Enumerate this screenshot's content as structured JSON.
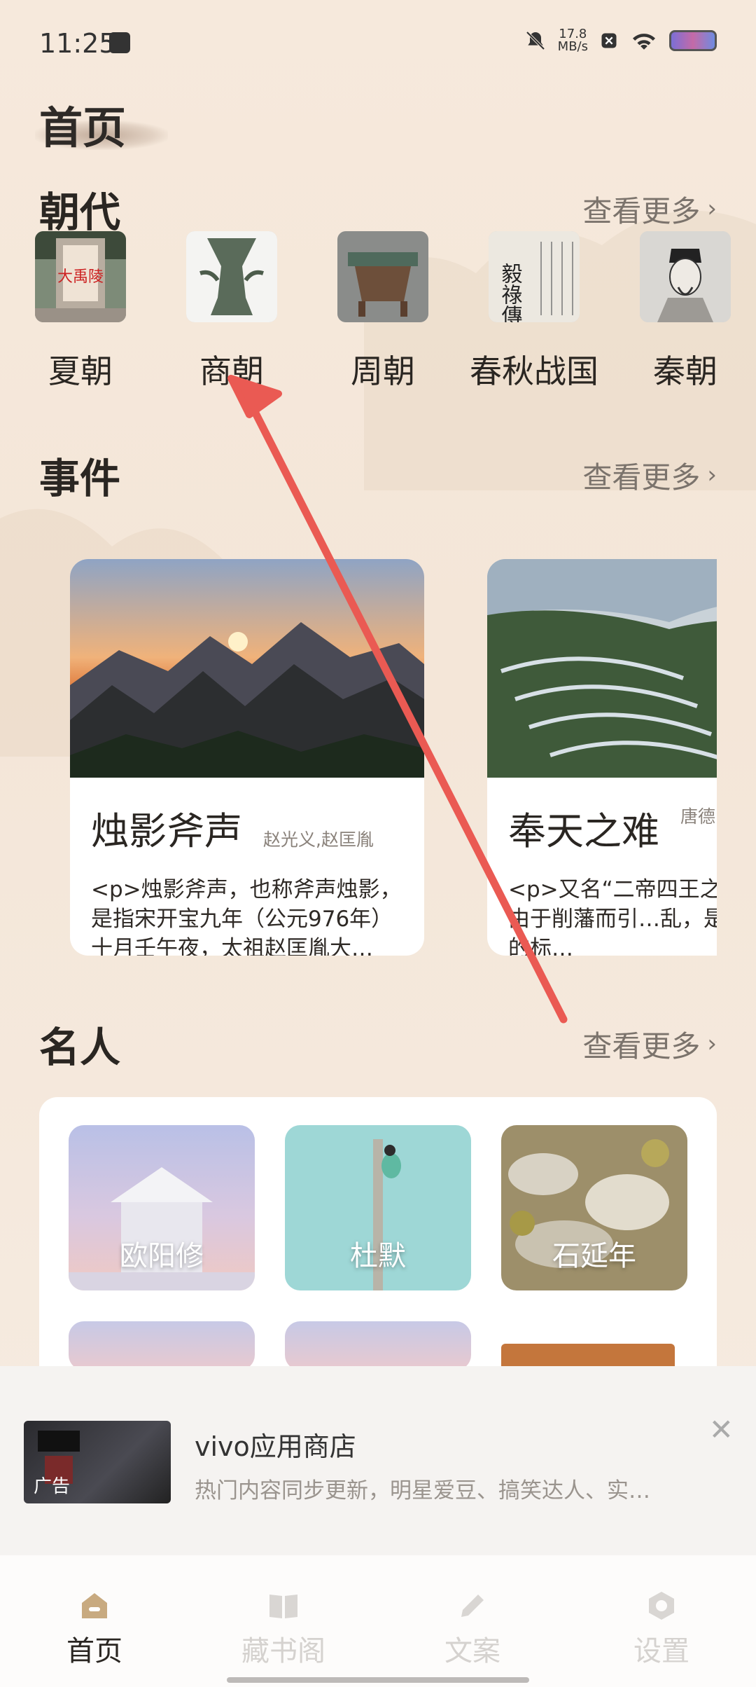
{
  "status_bar": {
    "time": "11:25",
    "speed_value": "17.8",
    "speed_unit": "MB/s"
  },
  "page": {
    "title": "首页"
  },
  "dynasties": {
    "title": "朝代",
    "more": "查看更多",
    "items": [
      {
        "label": "夏朝"
      },
      {
        "label": "商朝"
      },
      {
        "label": "周朝"
      },
      {
        "label": "春秋战国"
      },
      {
        "label": "秦朝"
      }
    ],
    "thumb_text_0": "大禹陵",
    "thumb_text_3": "毅祿傳"
  },
  "events": {
    "title": "事件",
    "more": "查看更多",
    "items": [
      {
        "title": "烛影斧声",
        "people": "赵光义,赵匡胤",
        "desc": "<p>烛影斧声，也称斧声烛影，是指宋开宝九年（公元976年）十月壬午夜，太祖赵匡胤大…"
      },
      {
        "title": "奉天之难",
        "people": "唐德",
        "desc": "<p>又名“二帝四王之…是一场由于削藩而引…乱，是晚唐败落的标…"
      }
    ]
  },
  "celebrities": {
    "title": "名人",
    "more": "查看更多",
    "items": [
      {
        "name": "欧阳修"
      },
      {
        "name": "杜默"
      },
      {
        "name": "石延年"
      }
    ]
  },
  "ad": {
    "title": "vivo应用商店",
    "desc": "热门内容同步更新，明星爱豆、搞笑达人、实…",
    "badge": "广告"
  },
  "tabs": [
    {
      "label": "首页",
      "icon": "home-icon"
    },
    {
      "label": "藏书阁",
      "icon": "book-icon"
    },
    {
      "label": "文案",
      "icon": "pen-icon"
    },
    {
      "label": "设置",
      "icon": "settings-icon"
    }
  ]
}
